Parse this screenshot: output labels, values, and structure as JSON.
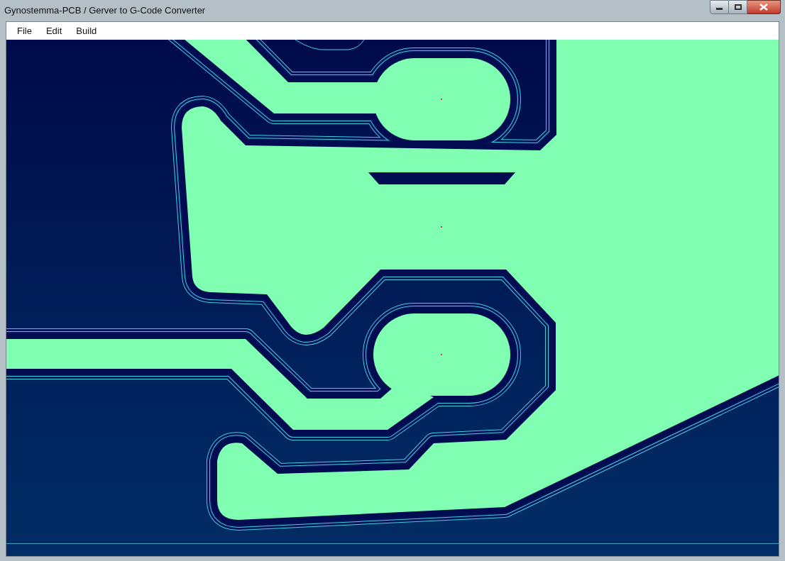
{
  "window": {
    "title": "Gynostemma-PCB / Gerver to G-Code Converter"
  },
  "menu": [
    {
      "label": "File"
    },
    {
      "label": "Edit"
    },
    {
      "label": "Build"
    }
  ]
}
